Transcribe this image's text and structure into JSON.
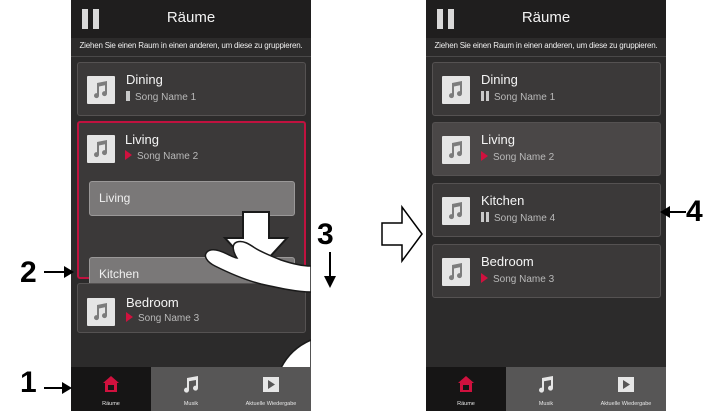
{
  "screens": [
    {
      "header": {
        "title": "Räume"
      },
      "hint": "Ziehen Sie einen Raum in einen anderen, um diese zu gruppieren.",
      "rooms": [
        {
          "name": "Dining",
          "song": "Song Name 1"
        },
        {
          "name": "Living",
          "song": "Song Name 2"
        },
        {
          "name": "Bedroom",
          "song": "Song Name 3"
        }
      ],
      "drop_targets": [
        "Living",
        "Kitchen"
      ],
      "tabs": [
        {
          "label": "Räume"
        },
        {
          "label": "Musik"
        },
        {
          "label": "Aktuelle Wiedergabe"
        }
      ]
    },
    {
      "header": {
        "title": "Räume"
      },
      "hint": "Ziehen Sie einen Raum in einen anderen, um diese zu gruppieren.",
      "rooms": [
        {
          "name": "Dining",
          "song": "Song Name 1"
        },
        {
          "name": "Living",
          "song": "Song Name 2"
        },
        {
          "name": "Kitchen",
          "song": "Song Name 4"
        },
        {
          "name": "Bedroom",
          "song": "Song Name 3"
        }
      ],
      "tabs": [
        {
          "label": "Räume"
        },
        {
          "label": "Musik"
        },
        {
          "label": "Aktuelle Wiedergabe"
        }
      ]
    }
  ],
  "annotations": {
    "step1": "1",
    "step2": "2",
    "step3": "3",
    "step4": "4"
  },
  "icons": {
    "pause": "pause-icon",
    "music_note": "music-note-icon",
    "rooms_tab": "house-icon",
    "music_tab": "music-note-icon",
    "now_playing_tab": "play-icon",
    "hand": "hand-pointer-icon",
    "down_arrow": "down-arrow-icon",
    "right_arrow": "right-arrow-icon"
  },
  "colors": {
    "accent": "#c0123f",
    "background": "#2c2b2b",
    "topbar": "#1f1e1e"
  }
}
